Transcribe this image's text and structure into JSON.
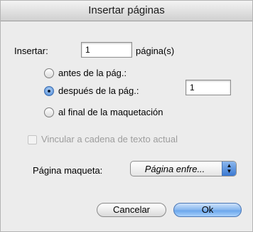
{
  "dialog": {
    "title": "Insertar páginas",
    "insert_label": "Insertar:",
    "insert_value": "1",
    "pages_unit": "página(s)",
    "position_options": [
      {
        "label": "antes de la pág.:",
        "selected": false
      },
      {
        "label": "después de la pág.:",
        "selected": true
      },
      {
        "label": "al final de la maquetación",
        "selected": false
      }
    ],
    "after_page_value": "1",
    "link_checkbox": {
      "label": "Vincular a cadena de texto actual",
      "checked": false,
      "enabled": false
    },
    "master_page_label": "Página maqueta:",
    "master_page_value": "Página enfre...",
    "cancel_label": "Cancelar",
    "ok_label": "Ok",
    "colors": {
      "background": "#ececec",
      "default_button": "#6aa6ec",
      "disabled_text": "#9d9d9d"
    }
  }
}
